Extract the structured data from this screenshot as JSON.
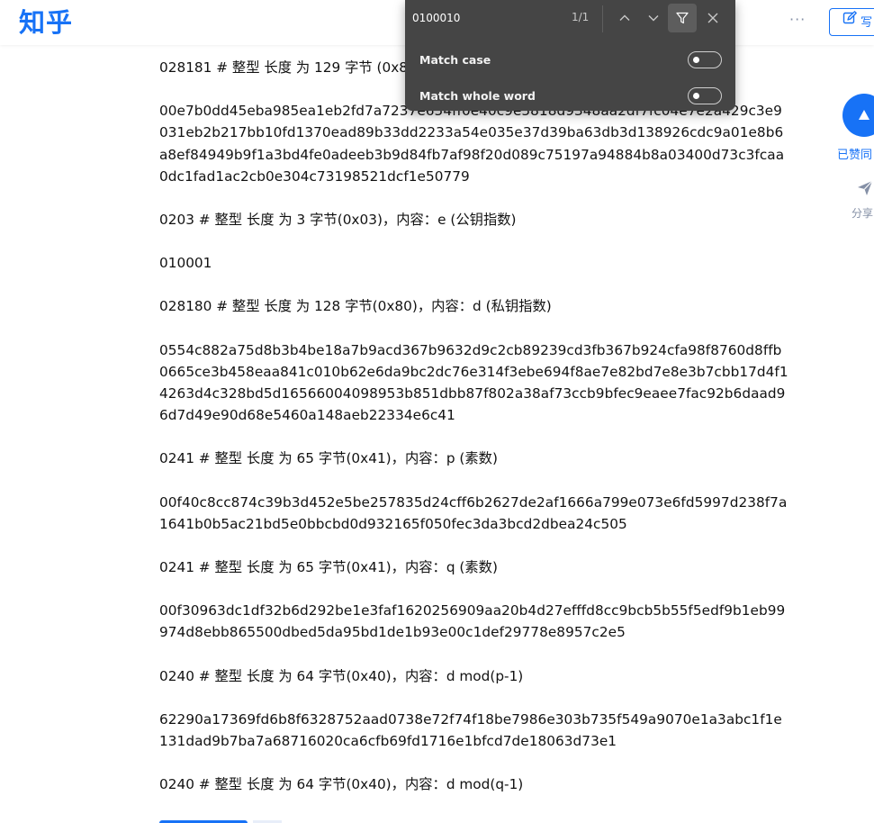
{
  "header": {
    "logo_text": "知乎",
    "more_label": "···",
    "write_label": "写"
  },
  "find_bar": {
    "query": "0100010",
    "count": "1/1",
    "match_case_label": "Match case",
    "match_whole_word_label": "Match whole word",
    "match_case_enabled": false,
    "match_whole_word_enabled": false
  },
  "side": {
    "like_label": "已赞同",
    "share_label": "分享"
  },
  "article": {
    "paragraphs": [
      "028181 # 整型 长度 为 129 字节 (0x81)，内容：n (模数)",
      "00e7b0dd45eba985ea1eb2fd7a7237e654ff0e40c9e5818d9348aa2df7fc04e7e2a429c3e9031eb2b217bb10fd1370ead89b33dd2233a54e035e37d39ba63db3d138926cdc9a01e8b6a8ef84949b9f1a3bd4fe0adeeb3b9d84fb7af98f20d089c75197a94884b8a03400d73c3fcaa0dc1fad1ac2cb0e304c73198521dcf1e50779",
      "0203 # 整型 长度 为 3 字节(0x03)，内容：e (公钥指数)",
      "010001",
      "028180 # 整型 长度 为 128 字节(0x80)，内容：d (私钥指数)",
      "0554c882a75d8b3b4be18a7b9acd367b9632d9c2cb89239cd3fb367b924cfa98f8760d8ffb0665ce3b458eaa841c010b62e6da9bc2dc76e314f3ebe694f8ae7e82bd7e8e3b7cbb17d4f14263d4c328bd5d16566004098953b851dbb87f802a38af73ccb9bfec9eaee7fac92b6daad96d7d49e90d68e5460a148aeb22334e6c41",
      "0241 # 整型 长度 为 65 字节(0x41)，内容：p (素数)",
      "00f40c8cc874c39b3d452e5be257835d24cff6b2627de2af1666a799e073e6fd5997d238f7a1641b0b5ac21bd5e0bbcbd0d932165f050fec3da3bcd2dbea24c505",
      "0241 # 整型 长度 为 65 字节(0x41)，内容：q (素数)",
      "00f30963dc1df32b6d292be1e3faf1620256909aa20b4d27efffd8cc9bcb5b55f5edf9b1eb99974d8ebb865500dbed5da95bd1de1b93e00c1def29778e8957c2e5",
      "0240 # 整型 长度 为 64 字节(0x40)，内容：d mod(p-1)",
      "62290a17369fd6b8f6328752aad0738e72f74f18be7986e303b735f549a9070e1a3abc1f1e131dad9b7ba7a68716020ca6cfb69fd1716e1bfcd7de18063d73e1",
      "0240 # 整型 长度 为 64 字节(0x40)，内容：d mod(q-1)"
    ]
  },
  "colors": {
    "brand_blue": "#1772f6",
    "findbar_bg": "#454545",
    "text": "#121212",
    "muted": "#8590a6"
  }
}
